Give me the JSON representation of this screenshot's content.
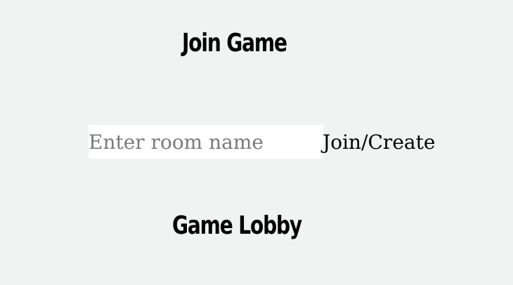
{
  "join_section": {
    "title": "Join Game",
    "room_input": {
      "placeholder": "Enter room name",
      "value": ""
    },
    "join_button_label": "Join/Create"
  },
  "lobby_section": {
    "title": "Game Lobby"
  }
}
